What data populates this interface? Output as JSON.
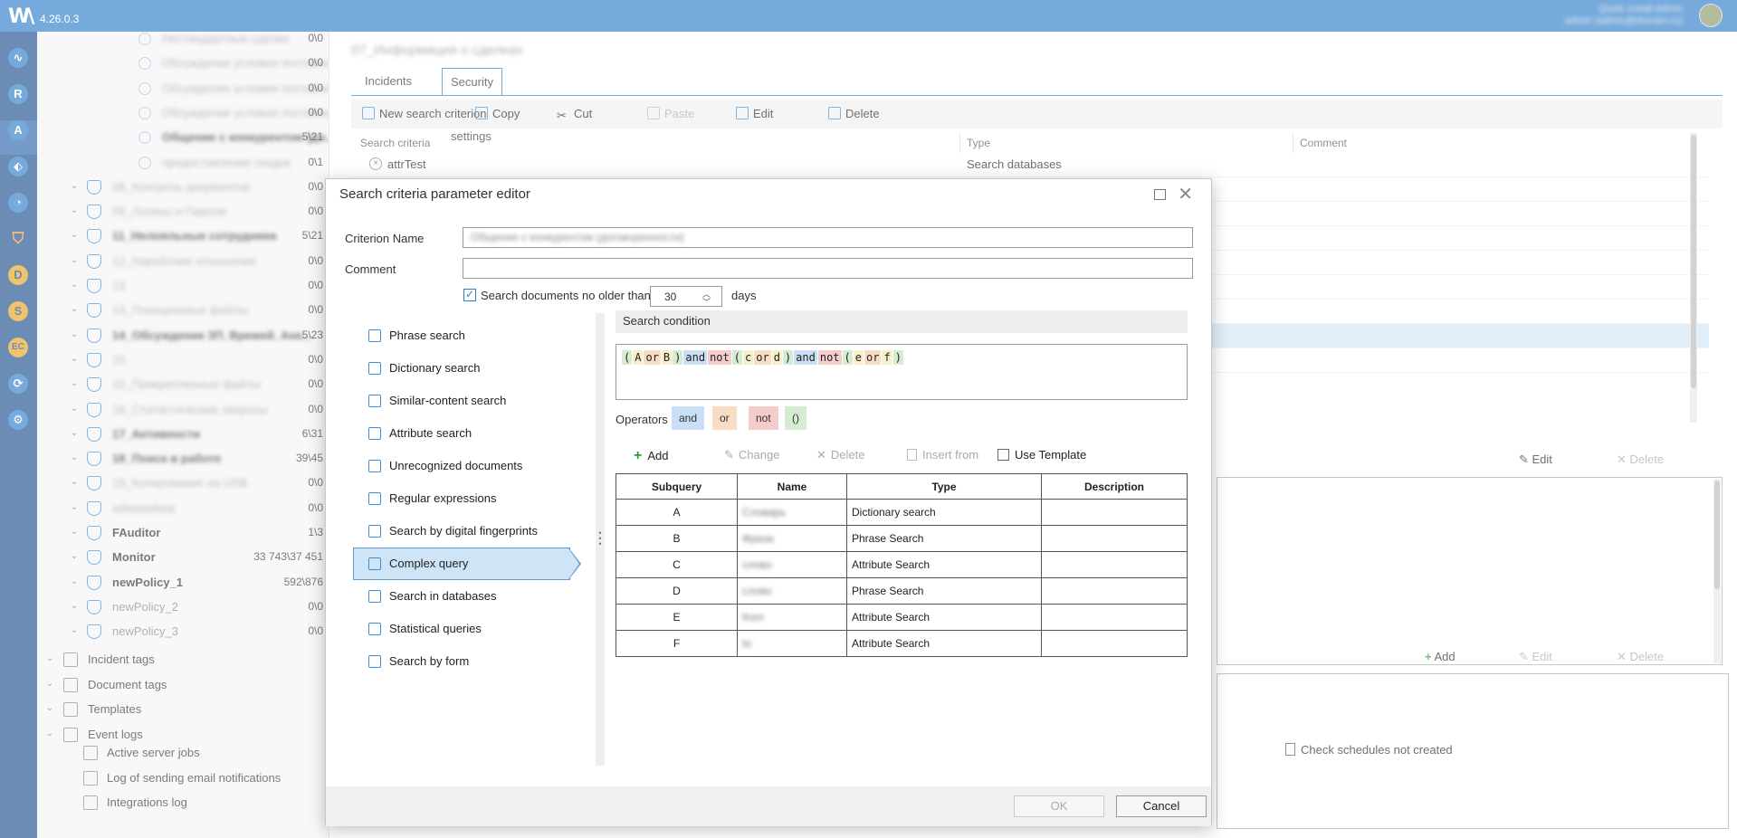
{
  "app": {
    "version": "4.26.0.3",
    "user_line1": "Quick install Admin",
    "user_line2": "admin (admin@domain.ru)"
  },
  "nav_icons": [
    {
      "name": "dashboard-icon",
      "glyph": "∿"
    },
    {
      "name": "reports-icon",
      "glyph": "R"
    },
    {
      "name": "analytics-icon",
      "glyph": "A"
    },
    {
      "name": "policy-icon",
      "glyph": "⬖"
    },
    {
      "name": "monitor-icon",
      "glyph": "◔"
    },
    {
      "name": "shield-icon",
      "glyph": "⛉"
    },
    {
      "name": "d-module-icon",
      "glyph": "D"
    },
    {
      "name": "s-module-icon",
      "glyph": "S"
    },
    {
      "name": "ec-module-icon",
      "glyph": "EC"
    },
    {
      "name": "sync-icon",
      "glyph": "⟳"
    },
    {
      "name": "settings-icon",
      "glyph": "⚙"
    }
  ],
  "tree": {
    "items": [
      {
        "label": "Нестандартные сделки",
        "count": "0\\0",
        "style": "blur",
        "kind": "circle"
      },
      {
        "label": "Обсуждение условия поставки",
        "count": "0\\0",
        "style": "blur",
        "kind": "circle"
      },
      {
        "label": "Обсуждение условия поставки (1)",
        "count": "0\\0",
        "style": "blur",
        "kind": "circle"
      },
      {
        "label": "Обсуждение условия поставки (2)",
        "count": "0\\0",
        "style": "blur",
        "kind": "circle"
      },
      {
        "label": "Общение с конкурентом (до...",
        "count": "5\\21",
        "style": "blurbold",
        "kind": "circle"
      },
      {
        "label": "предоставление скидок",
        "count": "0\\1",
        "style": "blur",
        "kind": "circle"
      },
      {
        "label": "08_Контроль документов",
        "count": "0\\0",
        "style": "blur",
        "kind": "shield"
      },
      {
        "label": "09_Логины и Пароли",
        "count": "0\\0",
        "style": "blur",
        "kind": "shield"
      },
      {
        "label": "11_Нелояльные сотрудники",
        "count": "5\\21",
        "style": "blurbold",
        "kind": "shield"
      },
      {
        "label": "12_Нарабочие отношения",
        "count": "0\\0",
        "style": "blur",
        "kind": "shield"
      },
      {
        "label": "13",
        "count": "0\\0",
        "style": "blur",
        "kind": "shield"
      },
      {
        "label": "13_Позиционные файлы",
        "count": "0\\0",
        "style": "blur",
        "kind": "shield"
      },
      {
        "label": "14_Обсуждение 3П. Времей. Анк...",
        "count": "5\\23",
        "style": "blurbold",
        "kind": "shield"
      },
      {
        "label": "15",
        "count": "0\\0",
        "style": "blur",
        "kind": "shield"
      },
      {
        "label": "15_Прикрепленные файлы",
        "count": "0\\0",
        "style": "blur",
        "kind": "shield"
      },
      {
        "label": "16_Статистические запросы",
        "count": "0\\0",
        "style": "blur",
        "kind": "shield"
      },
      {
        "label": "17_Активности",
        "count": "6\\31",
        "style": "blurbold",
        "kind": "shield"
      },
      {
        "label": "18_Поиск в работе",
        "count": "39\\45",
        "style": "blurbold",
        "kind": "shield"
      },
      {
        "label": "19_Копирование на USB",
        "count": "0\\0",
        "style": "blur",
        "kind": "shield"
      },
      {
        "label": "adwatadwat",
        "count": "0\\0",
        "style": "blur",
        "kind": "shield"
      },
      {
        "label": "FAuditor",
        "count": "1\\3",
        "style": "bold",
        "kind": "shield"
      },
      {
        "label": "Monitor",
        "count": "33 743\\37 451",
        "style": "bold",
        "kind": "shield"
      },
      {
        "label": "newPolicy_1",
        "count": "592\\876",
        "style": "bold",
        "kind": "shield"
      },
      {
        "label": "newPolicy_2",
        "count": "0\\0",
        "style": "gray",
        "kind": "shield"
      },
      {
        "label": "newPolicy_3",
        "count": "0\\0",
        "style": "gray",
        "kind": "shield"
      }
    ],
    "sections": [
      {
        "label": "Incident tags"
      },
      {
        "label": "Document tags"
      },
      {
        "label": "Templates"
      },
      {
        "label": "Event logs"
      }
    ],
    "event_logs": [
      {
        "label": "Active server jobs"
      },
      {
        "label": "Log of sending email notifications"
      },
      {
        "label": "Integrations log"
      }
    ]
  },
  "main": {
    "title": "07_Информация о сделках",
    "tabs": [
      {
        "label": "Incidents"
      },
      {
        "label": "Security policy settings"
      }
    ],
    "toolbar": {
      "new_label": "New search criterion",
      "copy_label": "Copy",
      "cut_label": "Cut",
      "paste_label": "Paste",
      "edit_label": "Edit",
      "delete_label": "Delete"
    },
    "grid": {
      "col_criteria": "Search criteria",
      "col_type": "Type",
      "col_comment": "Comment",
      "row1_name": "attrTest",
      "row1_type": "Search databases"
    },
    "lower": {
      "edit_label": "Edit",
      "delete_label": "Delete",
      "add_label": "Add",
      "edit2_label": "Edit",
      "delete2_label": "Delete",
      "check_label": "Check schedules not created"
    }
  },
  "modal": {
    "title": "Search criteria parameter editor",
    "criterion_label": "Criterion Name",
    "criterion_value": "Общение с конкурентом (договоренности)",
    "comment_label": "Comment",
    "comment_value": "",
    "no_older_label": "Search documents no older than",
    "no_older_checked": true,
    "days_value": "30",
    "days_label": "days",
    "categories": [
      {
        "label": "Phrase search",
        "icon": "phrase-search-icon"
      },
      {
        "label": "Dictionary search",
        "icon": "dictionary-icon"
      },
      {
        "label": "Similar-content search",
        "icon": "similar-content-icon"
      },
      {
        "label": "Attribute search",
        "icon": "attribute-icon"
      },
      {
        "label": "Unrecognized documents",
        "icon": "unrecognized-icon"
      },
      {
        "label": "Regular expressions",
        "icon": "regex-icon"
      },
      {
        "label": "Search by digital fingerprints",
        "icon": "fingerprint-icon"
      },
      {
        "label": "Complex query",
        "icon": "complex-query-icon"
      },
      {
        "label": "Search in databases",
        "icon": "database-icon"
      },
      {
        "label": "Statistical queries",
        "icon": "statistics-icon"
      },
      {
        "label": "Search by form",
        "icon": "form-icon"
      }
    ],
    "selected_category": "Complex query",
    "condition_header": "Search condition",
    "condition_tokens": [
      {
        "t": "(",
        "k": "par"
      },
      {
        "t": "A",
        "k": "sub"
      },
      {
        "t": "or",
        "k": "op-or"
      },
      {
        "t": "B",
        "k": "sub"
      },
      {
        "t": ")",
        "k": "par"
      },
      {
        "t": "and",
        "k": "op-and"
      },
      {
        "t": "not",
        "k": "op-not"
      },
      {
        "t": "(",
        "k": "par"
      },
      {
        "t": "c",
        "k": "sub"
      },
      {
        "t": "or",
        "k": "op-or"
      },
      {
        "t": "d",
        "k": "sub"
      },
      {
        "t": ")",
        "k": "par"
      },
      {
        "t": "and",
        "k": "op-and"
      },
      {
        "t": "not",
        "k": "op-not"
      },
      {
        "t": "(",
        "k": "par"
      },
      {
        "t": "e",
        "k": "sub"
      },
      {
        "t": "or",
        "k": "op-or"
      },
      {
        "t": "f",
        "k": "sub"
      },
      {
        "t": ")",
        "k": "par"
      }
    ],
    "operators_label": "Operators",
    "operators": [
      {
        "label": "and",
        "color": "#c9dff5"
      },
      {
        "label": "or",
        "color": "#f9dcc4"
      },
      {
        "label": "not",
        "color": "#f5cccc"
      },
      {
        "label": "()",
        "color": "#d6ecd2"
      }
    ],
    "subtoolbar": {
      "add_label": "Add",
      "change_label": "Change",
      "delete_label": "Delete",
      "insert_label": "Insert from",
      "template_label": "Use Template"
    },
    "table": {
      "headers": [
        "Subquery",
        "Name",
        "Type",
        "Description"
      ],
      "rows": [
        {
          "sub": "A",
          "name": "Словарь",
          "type": "Dictionary search",
          "desc": ""
        },
        {
          "sub": "B",
          "name": "Фраза",
          "type": "Phrase Search",
          "desc": ""
        },
        {
          "sub": "C",
          "name": "слово",
          "type": "Attribute Search",
          "desc": ""
        },
        {
          "sub": "D",
          "name": "слово",
          "type": "Phrase Search",
          "desc": ""
        },
        {
          "sub": "E",
          "name": "from",
          "type": "Attribute Search",
          "desc": ""
        },
        {
          "sub": "F",
          "name": "to",
          "type": "Attribute Search",
          "desc": ""
        }
      ]
    },
    "ok_label": "OK",
    "cancel_label": "Cancel"
  }
}
